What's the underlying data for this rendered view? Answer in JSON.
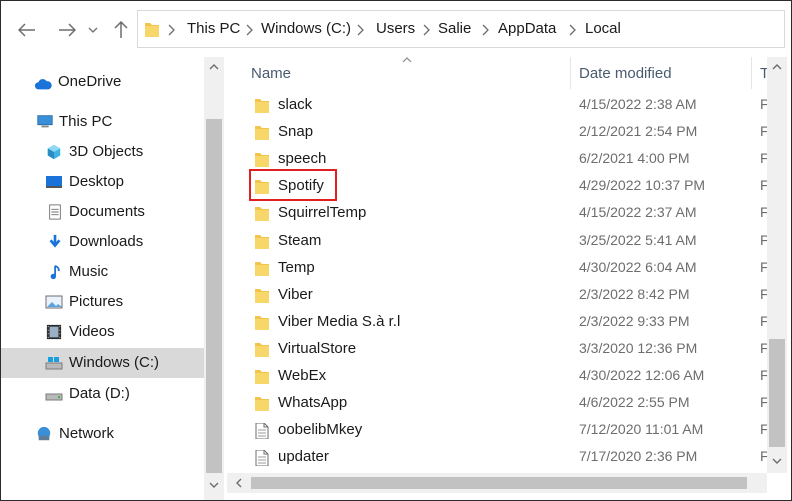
{
  "nav": {
    "back_icon": "arrow-left-icon",
    "forward_icon": "arrow-right-icon",
    "recent_icon": "chevron-down-icon",
    "up_icon": "arrow-up-icon"
  },
  "address": {
    "crumbs": [
      "This PC",
      "Windows (C:)",
      "Users",
      "Salie",
      "AppData",
      "Local"
    ]
  },
  "sidebar": {
    "items": [
      {
        "label": "OneDrive",
        "icon": "cloud-icon"
      },
      {
        "label": "This PC",
        "icon": "computer-icon"
      },
      {
        "label": "3D Objects",
        "icon": "cube-icon"
      },
      {
        "label": "Desktop",
        "icon": "desktop-icon"
      },
      {
        "label": "Documents",
        "icon": "document-icon"
      },
      {
        "label": "Downloads",
        "icon": "download-icon"
      },
      {
        "label": "Music",
        "icon": "music-icon"
      },
      {
        "label": "Pictures",
        "icon": "picture-icon"
      },
      {
        "label": "Videos",
        "icon": "video-icon"
      },
      {
        "label": "Windows (C:)",
        "icon": "drive-icon",
        "selected": true
      },
      {
        "label": "Data (D:)",
        "icon": "drive-icon"
      },
      {
        "label": "Network",
        "icon": "network-icon"
      }
    ]
  },
  "columns": {
    "name": "Name",
    "date": "Date modified",
    "type": "T"
  },
  "files": [
    {
      "name": "slack",
      "date": "4/15/2022 2:38 AM",
      "type": "F",
      "kind": "folder"
    },
    {
      "name": "Snap",
      "date": "2/12/2021 2:54 PM",
      "type": "F",
      "kind": "folder"
    },
    {
      "name": "speech",
      "date": "6/2/2021 4:00 PM",
      "type": "F",
      "kind": "folder"
    },
    {
      "name": "Spotify",
      "date": "4/29/2022 10:37 PM",
      "type": "F",
      "kind": "folder",
      "highlighted": true
    },
    {
      "name": "SquirrelTemp",
      "date": "4/15/2022 2:37 AM",
      "type": "F",
      "kind": "folder"
    },
    {
      "name": "Steam",
      "date": "3/25/2022 5:41 AM",
      "type": "F",
      "kind": "folder"
    },
    {
      "name": "Temp",
      "date": "4/30/2022 6:04 AM",
      "type": "F",
      "kind": "folder"
    },
    {
      "name": "Viber",
      "date": "2/3/2022 8:42 PM",
      "type": "F",
      "kind": "folder"
    },
    {
      "name": "Viber Media S.à r.l",
      "date": "2/3/2022 9:33 PM",
      "type": "F",
      "kind": "folder"
    },
    {
      "name": "VirtualStore",
      "date": "3/3/2020 12:36 PM",
      "type": "F",
      "kind": "folder"
    },
    {
      "name": "WebEx",
      "date": "4/30/2022 12:06 AM",
      "type": "F",
      "kind": "folder"
    },
    {
      "name": "WhatsApp",
      "date": "4/6/2022 2:55 PM",
      "type": "F",
      "kind": "folder"
    },
    {
      "name": "oobelibMkey",
      "date": "7/12/2020 11:01 AM",
      "type": "F",
      "kind": "file"
    },
    {
      "name": "updater",
      "date": "7/17/2020 2:36 PM",
      "type": "F",
      "kind": "file"
    }
  ],
  "colors": {
    "folder": "#f3c44b",
    "selection": "#d9d9d9",
    "highlight": "#e02020",
    "header_text": "#4a5b70"
  }
}
